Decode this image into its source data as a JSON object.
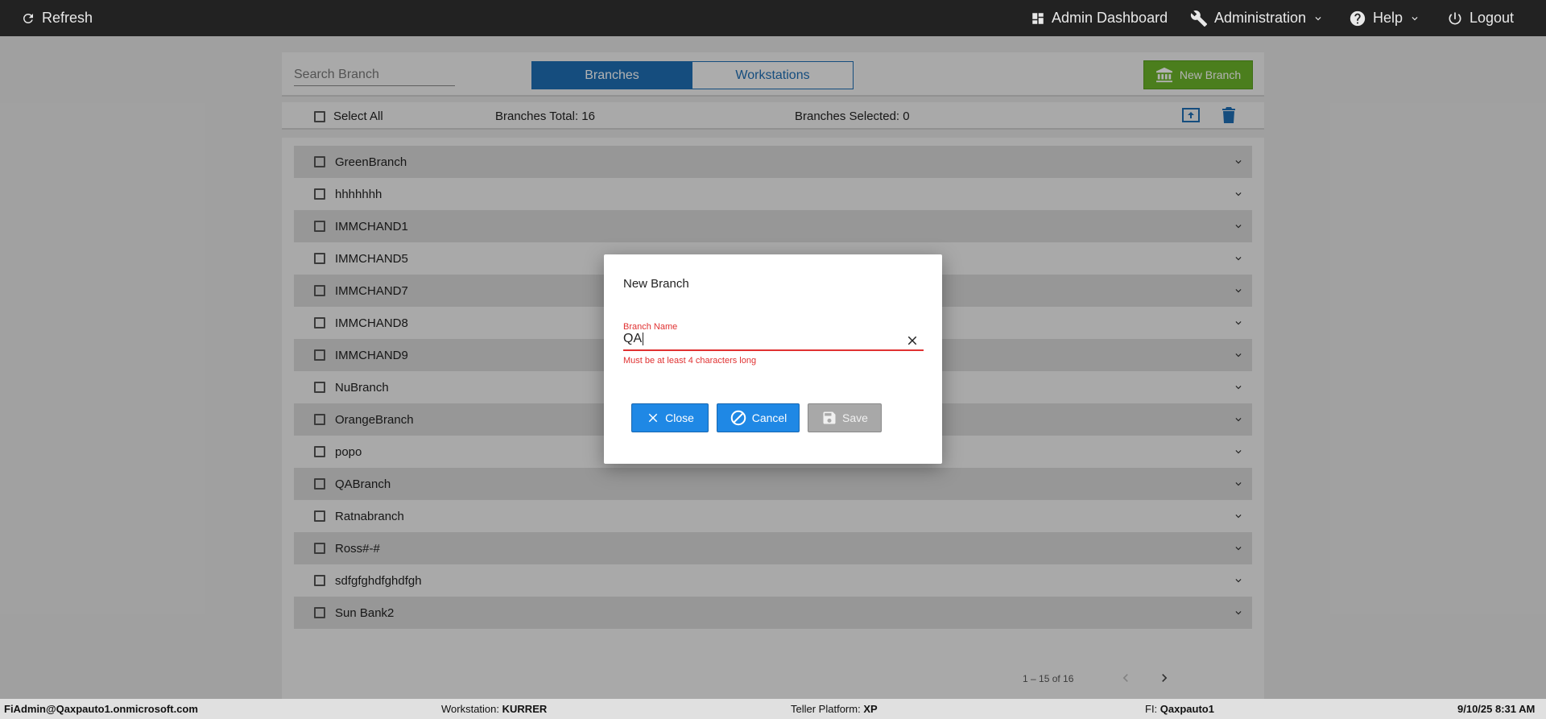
{
  "topbar": {
    "refresh_label": "Refresh",
    "admin_dashboard_label": "Admin Dashboard",
    "administration_label": "Administration",
    "help_label": "Help",
    "logout_label": "Logout"
  },
  "toolbar": {
    "search_placeholder": "Search Branch",
    "tabs": [
      {
        "label": "Branches",
        "active": true
      },
      {
        "label": "Workstations",
        "active": false
      }
    ],
    "new_branch_label": "New Branch",
    "accent_color": "#1f6fb5",
    "new_branch_color": "#6cb52a"
  },
  "selection_bar": {
    "select_all_label": "Select All",
    "branches_total": "Branches Total: 16",
    "branches_selected": "Branches Selected: 0"
  },
  "branches": [
    {
      "name": "GreenBranch"
    },
    {
      "name": "hhhhhhh"
    },
    {
      "name": "IMMCHAND1"
    },
    {
      "name": "IMMCHAND5"
    },
    {
      "name": "IMMCHAND7"
    },
    {
      "name": "IMMCHAND8"
    },
    {
      "name": "IMMCHAND9"
    },
    {
      "name": "NuBranch"
    },
    {
      "name": "OrangeBranch"
    },
    {
      "name": "popo"
    },
    {
      "name": "QABranch"
    },
    {
      "name": "Ratnabranch"
    },
    {
      "name": "Ross#-#"
    },
    {
      "name": "sdfgfghdfghdfgh"
    },
    {
      "name": "Sun Bank2"
    }
  ],
  "pager": {
    "range_label": "1 – 15 of 16"
  },
  "dialog": {
    "title": "New Branch",
    "field_label": "Branch Name",
    "field_value": "QA",
    "error": "Must be at least 4 characters long",
    "close_label": "Close",
    "cancel_label": "Cancel",
    "save_label": "Save",
    "error_color": "#e03131"
  },
  "statusbar": {
    "user": "FiAdmin@Qaxpauto1.onmicrosoft.com",
    "workstation_label": "Workstation:",
    "workstation_value": "KURRER",
    "platform_label": "Teller Platform:",
    "platform_value": "XP",
    "fi_label": "FI:",
    "fi_value": "Qaxpauto1",
    "datetime": "9/10/25 8:31 AM"
  }
}
